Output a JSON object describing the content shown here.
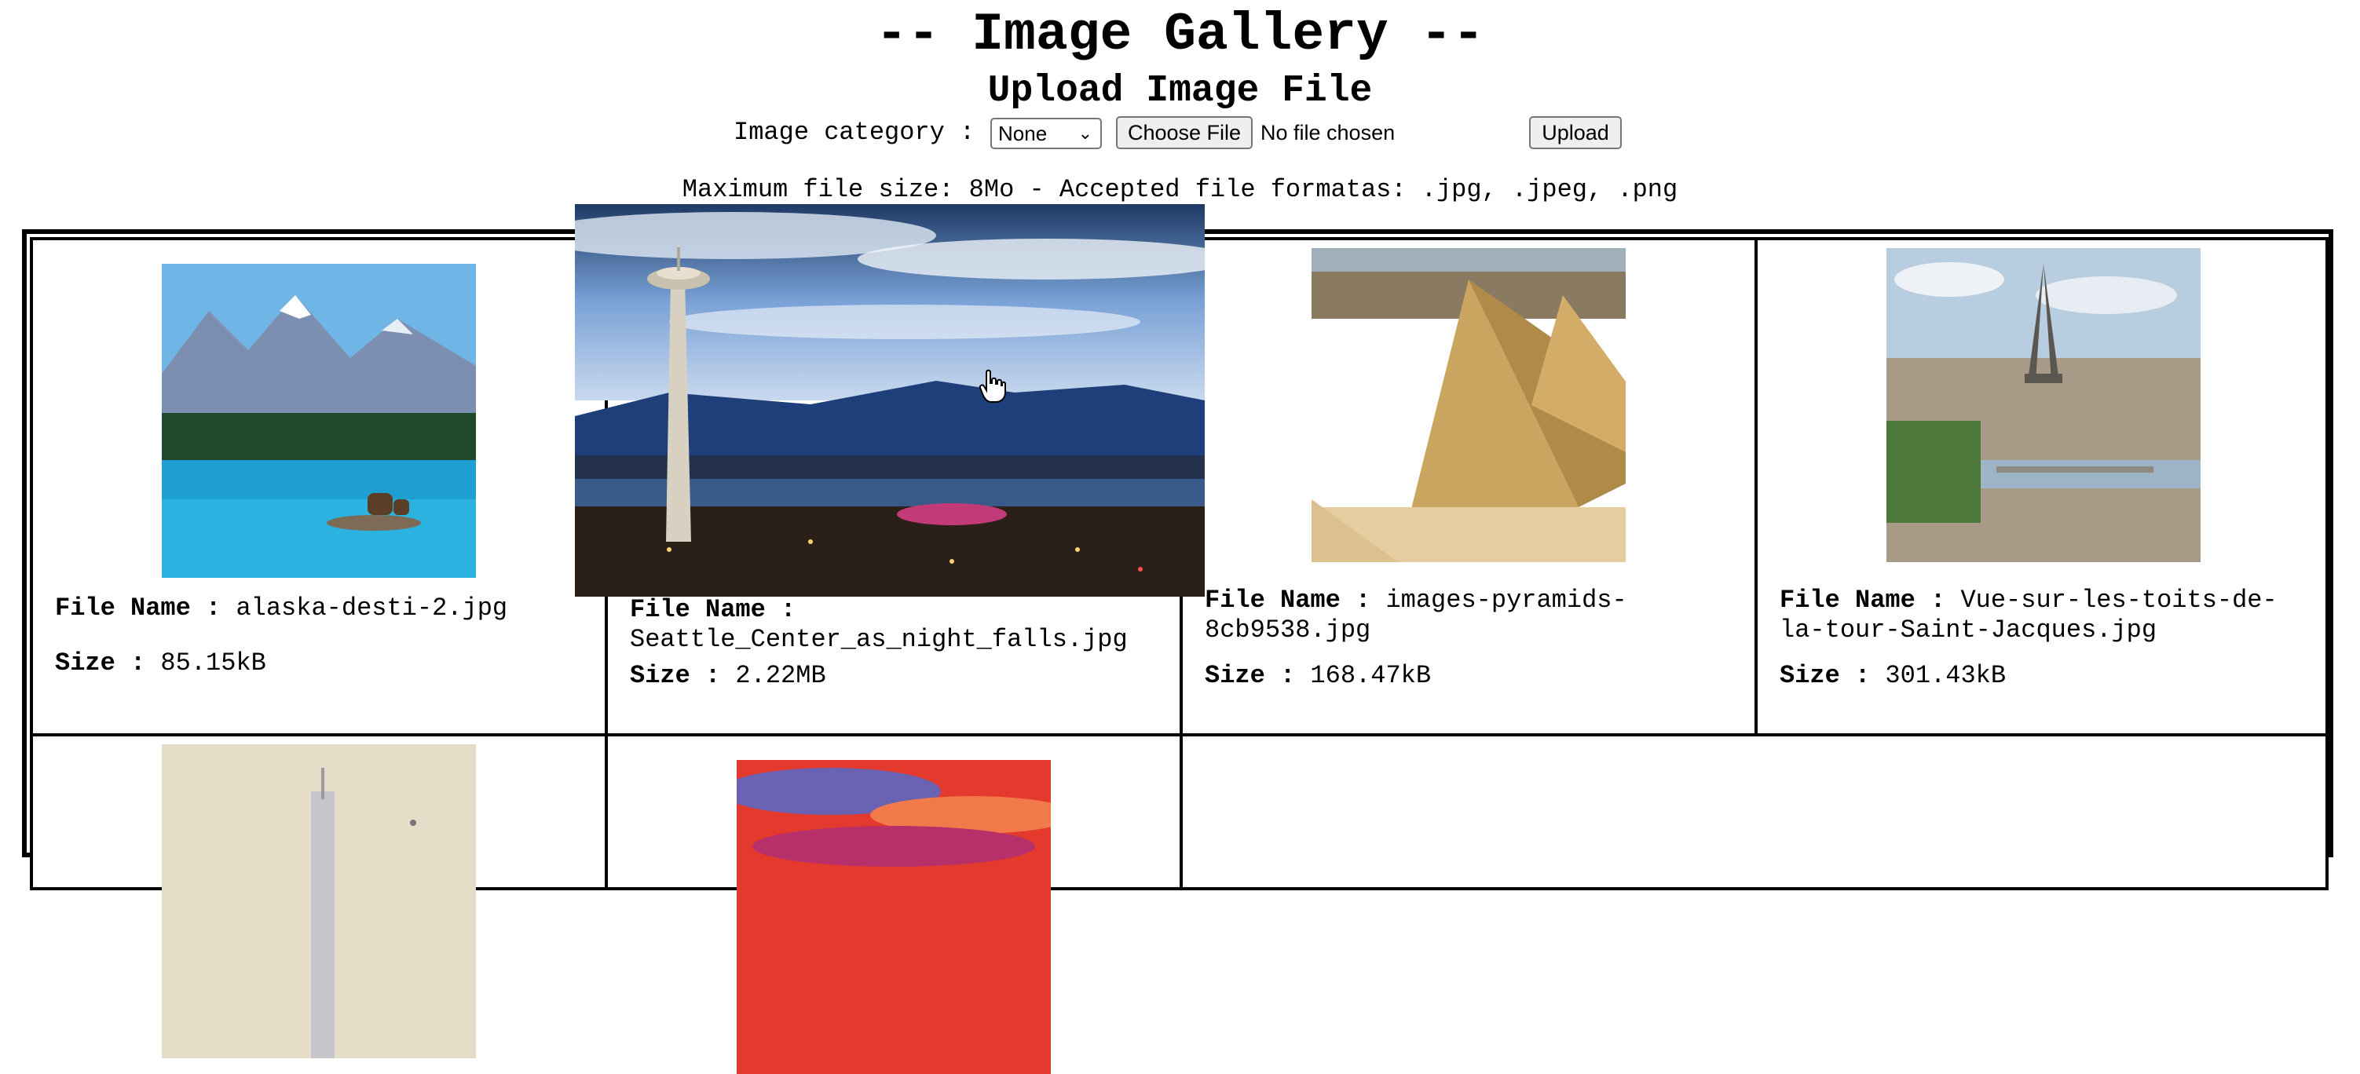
{
  "header": {
    "title": "-- Image Gallery --",
    "subtitle": "Upload Image File"
  },
  "upload": {
    "category_label": "Image category :",
    "category_selected": "None",
    "choose_file_label": "Choose File",
    "no_file_text": "No file chosen",
    "upload_label": "Upload",
    "limits_text": "Maximum file size: 8Mo - Accepted file formatas: .jpg, .jpeg, .png"
  },
  "gallery": {
    "file_name_label": "File Name :",
    "size_label": "Size :",
    "items": [
      {
        "file_name": "alaska-desti-2.jpg",
        "size": "85.15kB",
        "image": "alaska-lake-bear"
      },
      {
        "file_name": "Seattle_Center_as_night_falls.jpg",
        "size": "2.22MB",
        "image": "seattle-space-needle-night"
      },
      {
        "file_name": "images-pyramids-8cb9538.jpg",
        "size": "168.47kB",
        "image": "giza-pyramids"
      },
      {
        "file_name": "Vue-sur-les-toits-de-la-tour-Saint-Jacques.jpg",
        "size": "301.43kB",
        "image": "paris-eiffel-tower"
      },
      {
        "image": "skyscraper-skyline"
      },
      {
        "image": "red-sunset-sky"
      }
    ]
  },
  "colors": {
    "sky_blue": "#6fa7d8",
    "lake_blue": "#2a9fd0",
    "sand": "#d8b46c",
    "sunset_red": "#e43a2e",
    "night_blue": "#1e3a66"
  }
}
